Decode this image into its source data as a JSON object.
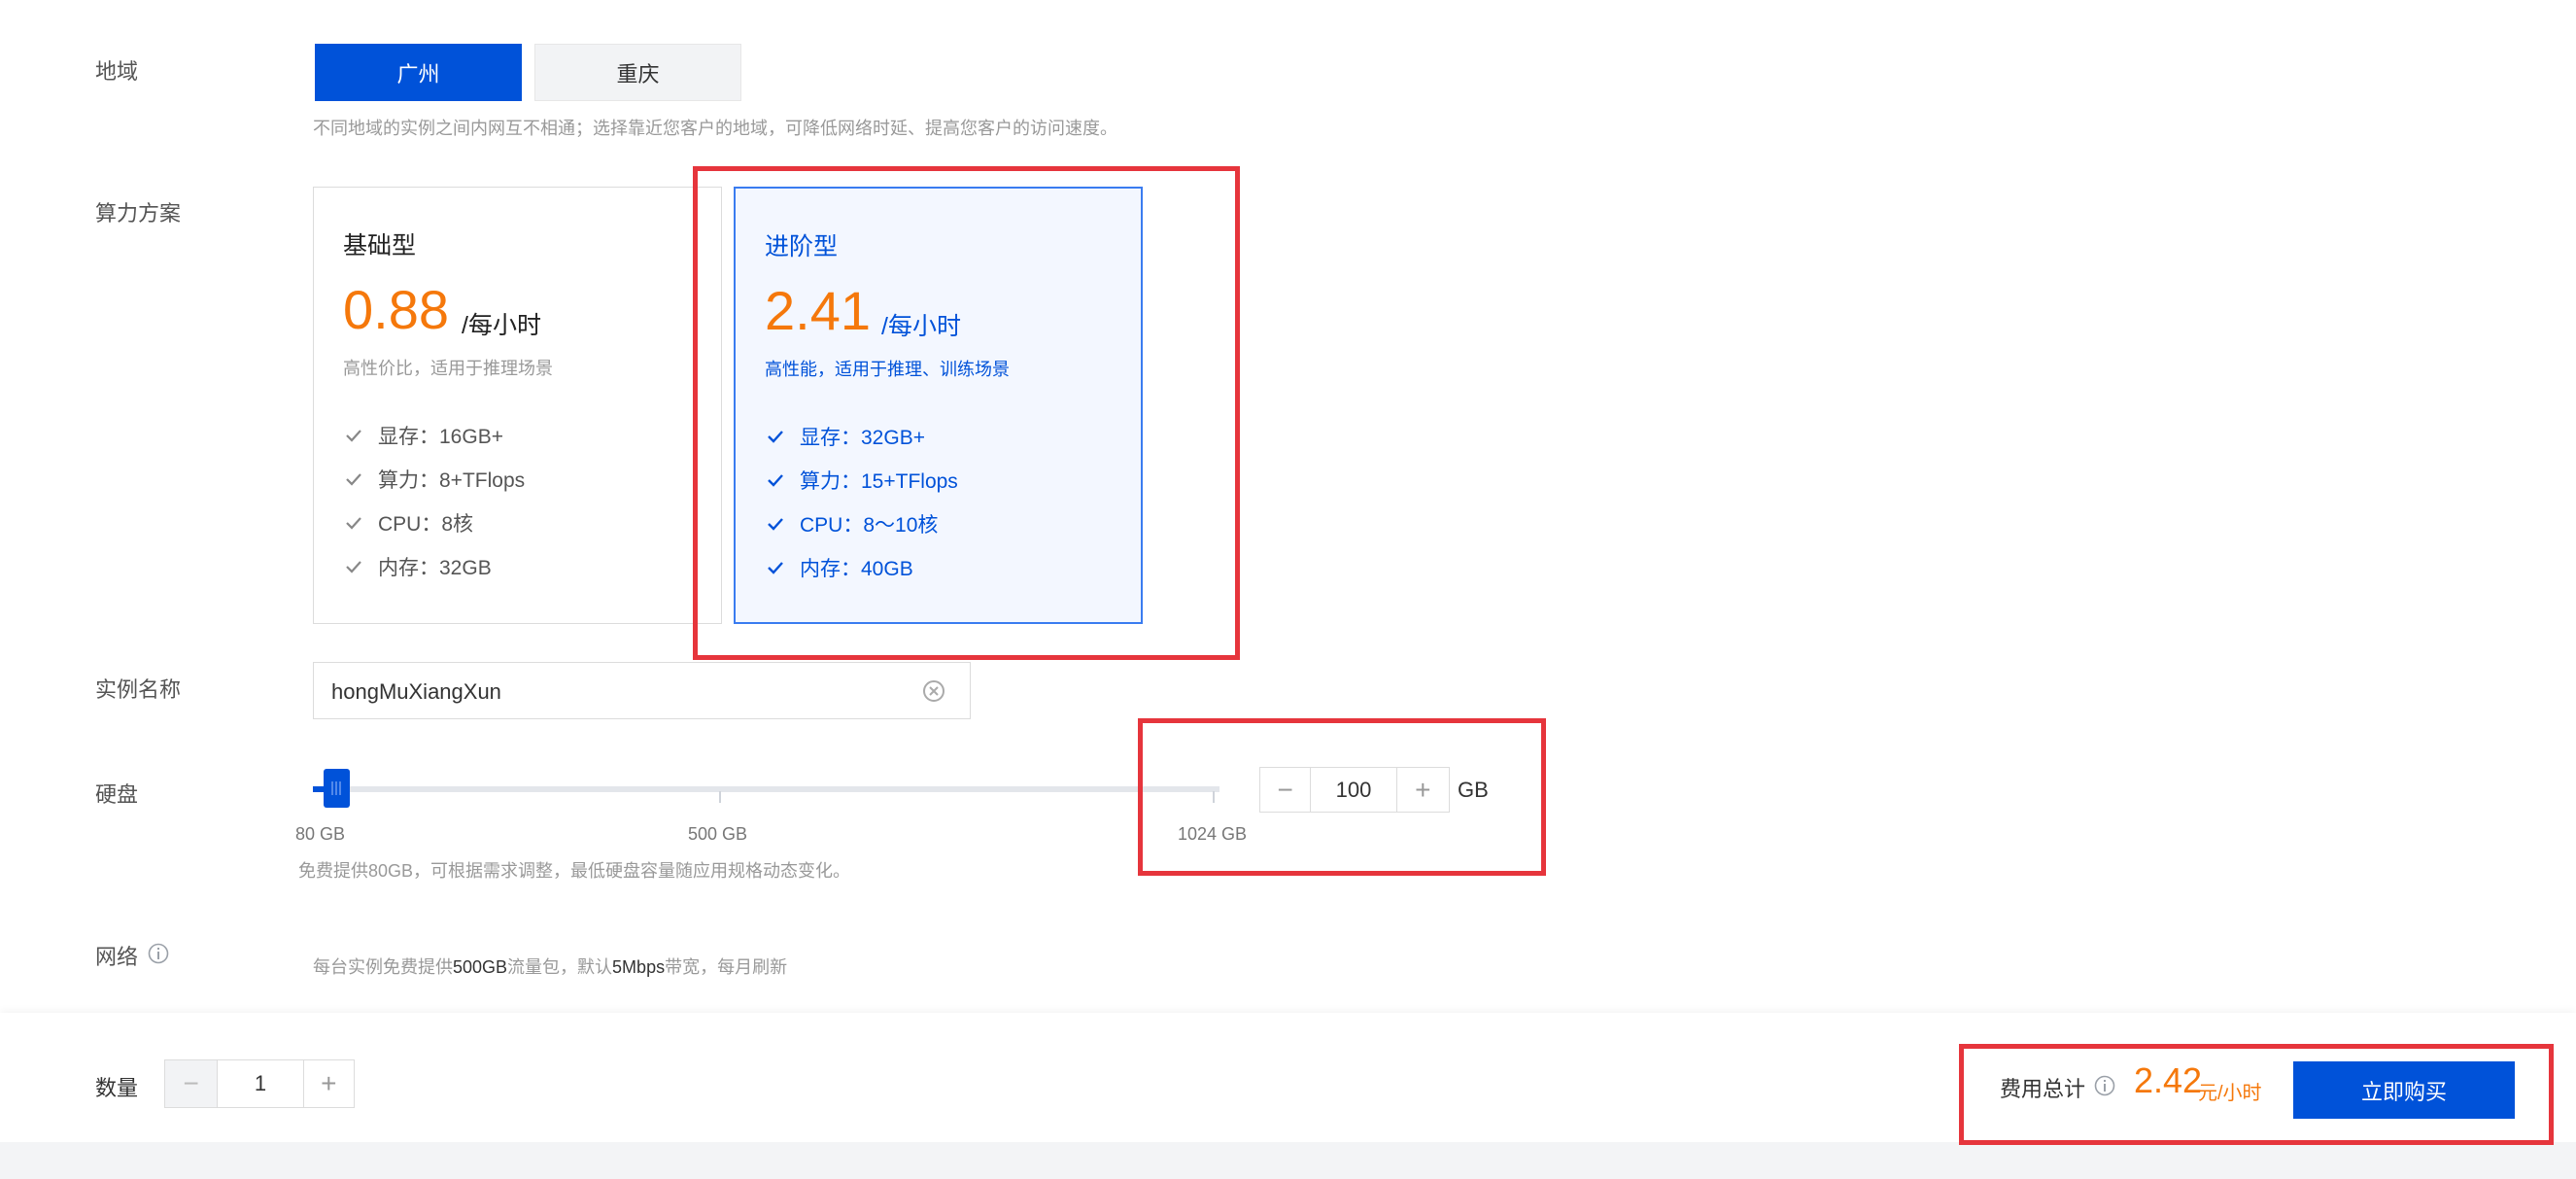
{
  "region": {
    "label": "地域",
    "options": [
      "广州",
      "重庆"
    ],
    "selected": "广州",
    "hint": "不同地域的实例之间内网互不相通；选择靠近您客户的地域，可降低网络时延、提高您客户的访问速度。"
  },
  "plan": {
    "label": "算力方案",
    "basic": {
      "name": "基础型",
      "price": "0.88",
      "unit": "/每小时",
      "desc": "高性价比，适用于推理场景",
      "specs": [
        "显存：16GB+",
        "算力：8+TFlops",
        "CPU：8核",
        "内存：32GB"
      ]
    },
    "advanced": {
      "name": "进阶型",
      "price": "2.41",
      "unit": "/每小时",
      "desc": "高性能，适用于推理、训练场景",
      "specs": [
        "显存：32GB+",
        "算力：15+TFlops",
        "CPU：8～10核",
        "内存：40GB"
      ]
    }
  },
  "instance_name": {
    "label": "实例名称",
    "value": "hongMuXiangXun"
  },
  "disk": {
    "label": "硬盘",
    "ticks": [
      "80 GB",
      "500 GB",
      "1024 GB"
    ],
    "value": "100",
    "unit": "GB",
    "hint": "免费提供80GB，可根据需求调整，最低硬盘容量随应用规格动态变化。"
  },
  "network": {
    "label": "网络",
    "hint_parts": [
      "每台实例免费提供",
      "500GB",
      "流量包，默认",
      "5Mbps",
      "带宽，每月刷新"
    ]
  },
  "quantity": {
    "label": "数量",
    "value": "1"
  },
  "total": {
    "label": "费用总计",
    "price": "2.42",
    "unit": "元/小时",
    "buy_label": "立即购买"
  },
  "colors": {
    "primary": "#0052d9",
    "price": "#f5780b",
    "highlight": "#e6353c"
  }
}
